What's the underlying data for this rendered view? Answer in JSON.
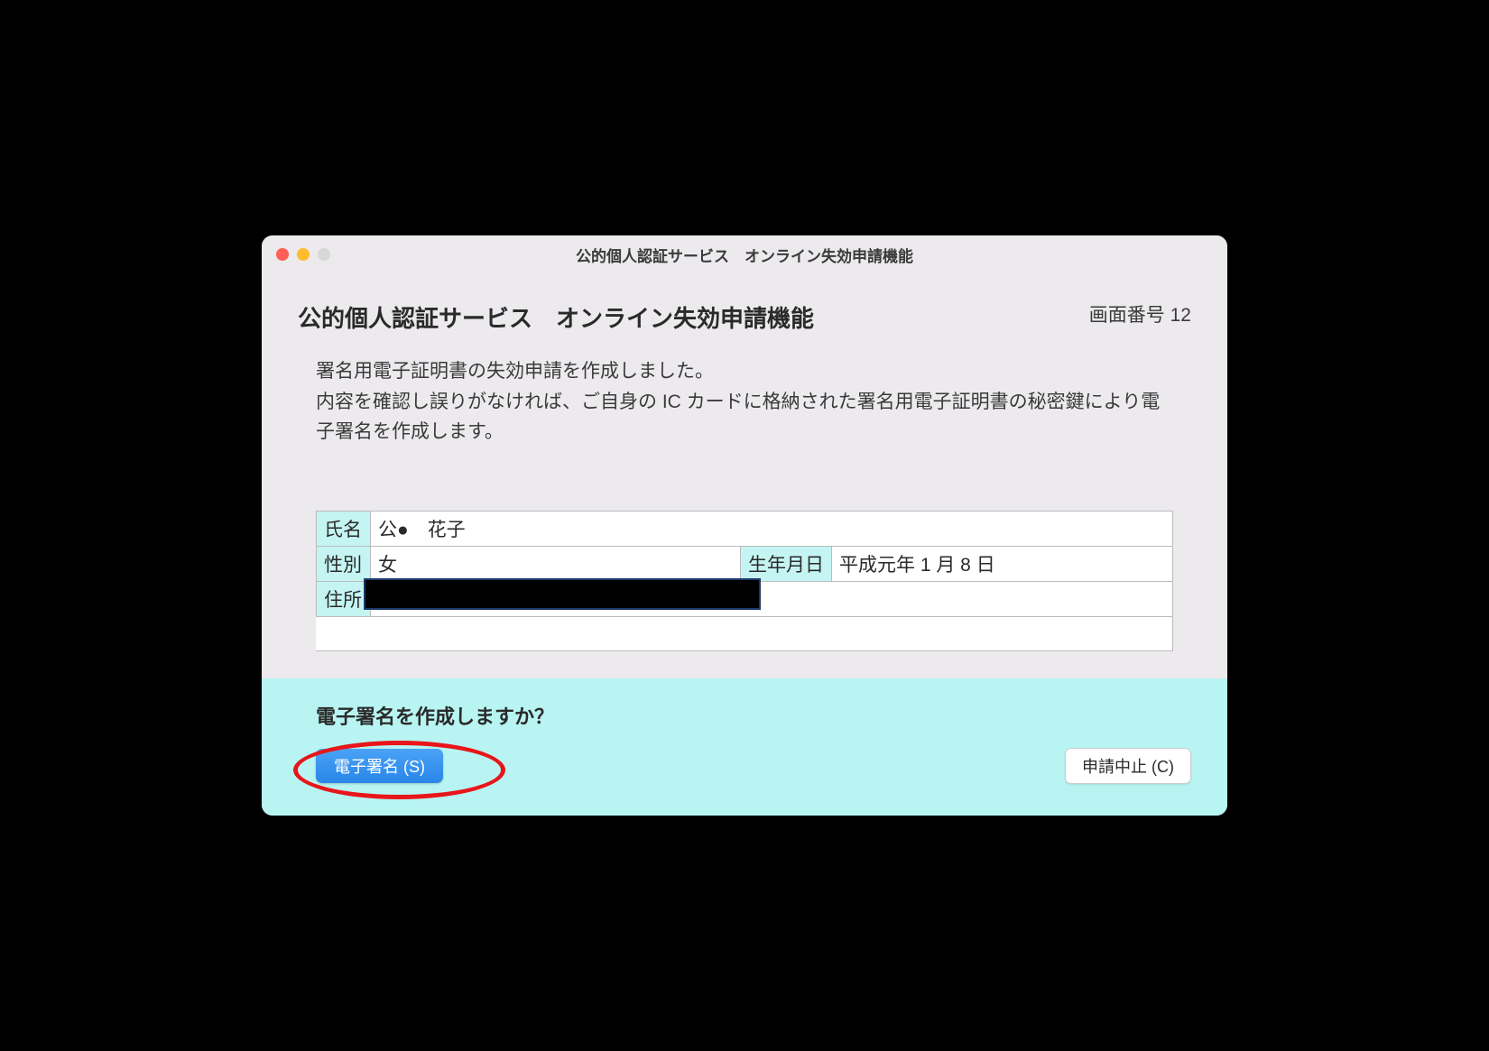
{
  "window": {
    "title": "公的個人認証サービス　オンライン失効申請機能"
  },
  "header": {
    "heading": "公的個人認証サービス　オンライン失効申請機能",
    "screen_number_label": "画面番号 12"
  },
  "description": {
    "line1": "署名用電子証明書の失効申請を作成しました。",
    "line2": "内容を確認し誤りがなければ、ご自身の IC カードに格納された署名用電子証明書の秘密鍵により電子署名を作成します。"
  },
  "table": {
    "name_label": "氏名",
    "name_value": "公●　花子",
    "gender_label": "性別",
    "gender_value": "女",
    "dob_label": "生年月日",
    "dob_value": "平成元年 1 月 8 日",
    "address_label": "住所",
    "address_value": ""
  },
  "footer": {
    "prompt": "電子署名を作成しますか？",
    "primary_button": "電子署名 (S)",
    "secondary_button": "申請中止 (C)"
  }
}
